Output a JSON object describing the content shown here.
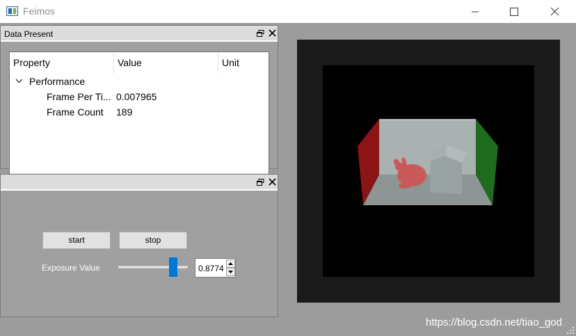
{
  "window": {
    "title": "Feimos",
    "icon": "app-window-icon",
    "controls": [
      "minimize-icon",
      "maximize-icon",
      "close-icon"
    ]
  },
  "dock_data": {
    "title": "Data Present",
    "buttons": [
      "float-icon",
      "close-icon"
    ],
    "tree": {
      "columns": [
        "Property",
        "Value",
        "Unit"
      ],
      "group": {
        "label": "Performance",
        "expanded": true,
        "rows": [
          {
            "property": "Frame Per Ti...",
            "value": "0.007965",
            "unit": ""
          },
          {
            "property": "Frame Count",
            "value": "189",
            "unit": ""
          }
        ]
      },
      "scrollbar": {
        "left_icon": "chevron-left-icon",
        "right_icon": "chevron-right-icon"
      }
    }
  },
  "dock_controls": {
    "title": "",
    "buttons": [
      "float-icon",
      "close-icon"
    ],
    "start_label": "start",
    "stop_label": "stop",
    "exposure_label": "Exposure Value",
    "exposure_value": "0.8774",
    "exposure_slider_fraction": 0.83
  },
  "viewport": {
    "description_icon": "cornell-box-render"
  },
  "watermark": "https://blog.csdn.net/tiao_god",
  "colors": {
    "accent": "#0078d7",
    "dock_background": "#a0a0a0",
    "left_wall": "#8b1414",
    "right_wall": "#1f6b1f"
  }
}
